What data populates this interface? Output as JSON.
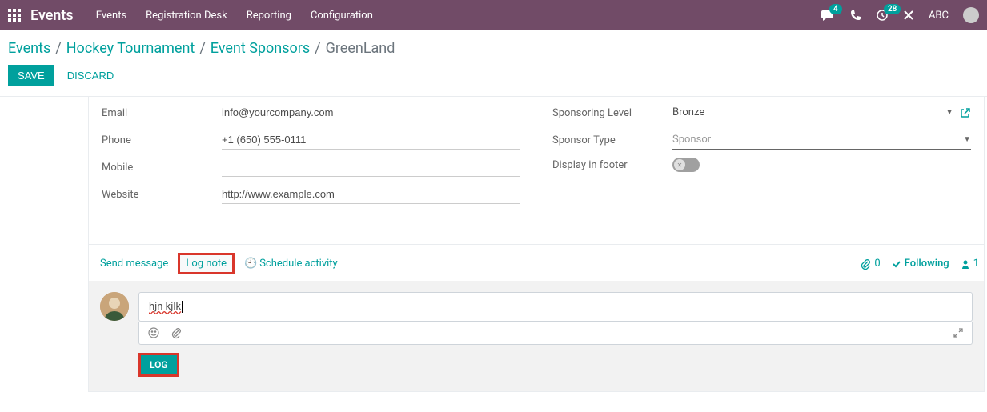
{
  "topbar": {
    "app_title": "Events",
    "nav": [
      "Events",
      "Registration Desk",
      "Reporting",
      "Configuration"
    ],
    "chat_count": "4",
    "activity_count": "28",
    "user_name": "ABC"
  },
  "breadcrumb": {
    "items": [
      "Events",
      "Hockey Tournament",
      "Event Sponsors"
    ],
    "current": "GreenLand"
  },
  "actions": {
    "save": "SAVE",
    "discard": "DISCARD"
  },
  "form": {
    "left": {
      "email_label": "Email",
      "email_value": "info@yourcompany.com",
      "phone_label": "Phone",
      "phone_value": "+1 (650) 555-0111",
      "mobile_label": "Mobile",
      "mobile_value": "",
      "website_label": "Website",
      "website_value": "http://www.example.com"
    },
    "right": {
      "level_label": "Sponsoring Level",
      "level_value": "Bronze",
      "type_label": "Sponsor Type",
      "type_placeholder": "Sponsor",
      "footer_label": "Display in footer",
      "footer_value": false
    }
  },
  "chatter": {
    "send_message": "Send message",
    "log_note": "Log note",
    "schedule_activity": "Schedule activity",
    "attachment_count": "0",
    "following": "Following",
    "follower_count": "1",
    "compose_text": "hjn kjlk",
    "log_button": "LOG"
  }
}
